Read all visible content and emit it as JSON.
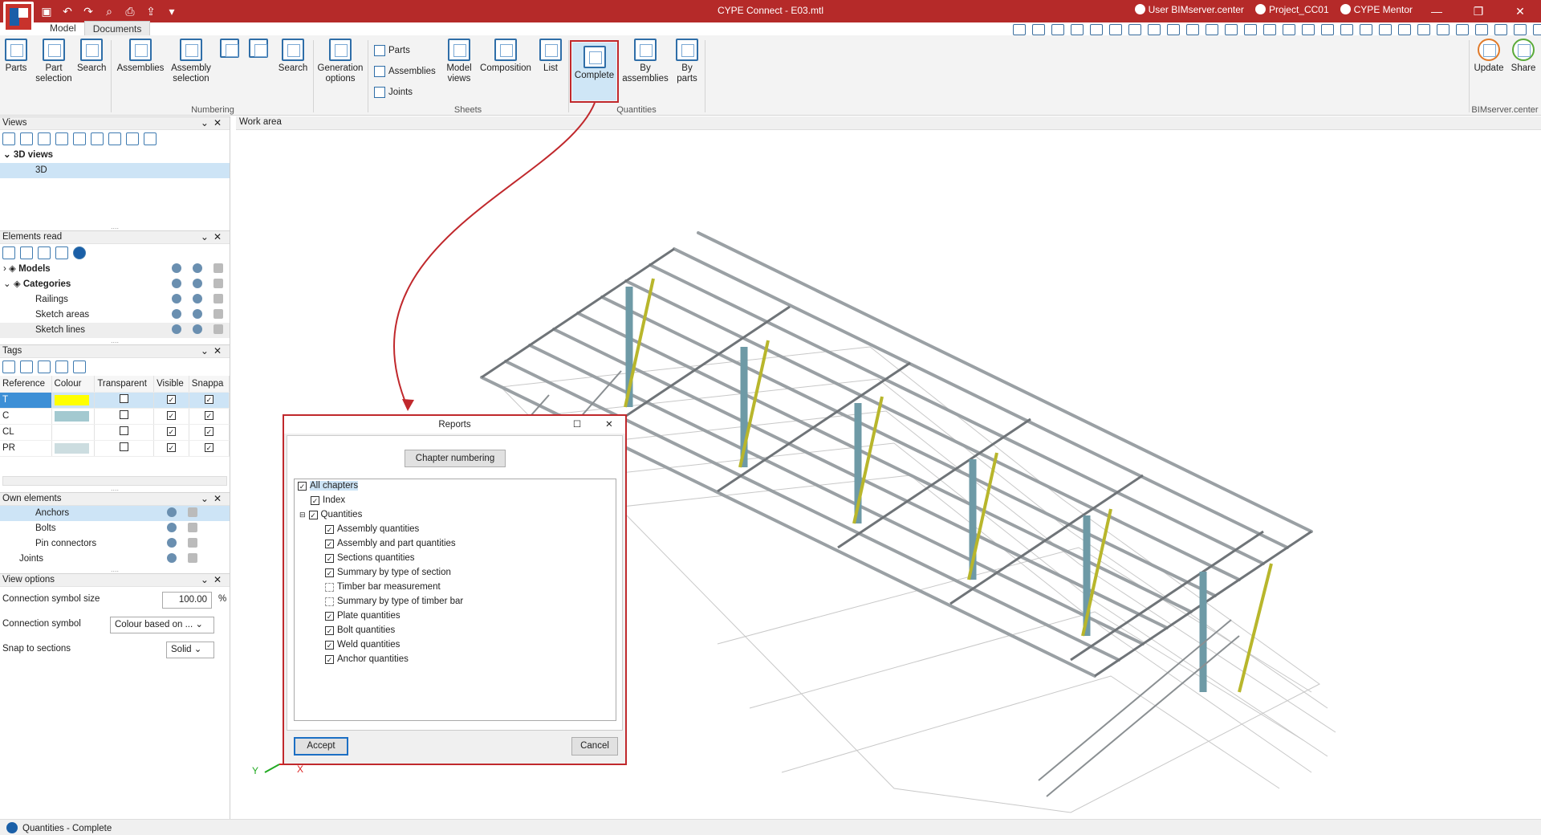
{
  "window": {
    "title": "CYPE Connect - E03.mtl"
  },
  "top_right": {
    "user": "User BIMserver.center",
    "project": "Project_CC01",
    "mentor": "CYPE Mentor"
  },
  "tabs": [
    {
      "label": "Model"
    },
    {
      "label": "Documents"
    }
  ],
  "ribbon": {
    "buttons": [
      {
        "label": "Parts"
      },
      {
        "label": "Part selection"
      },
      {
        "label": "Search"
      },
      {
        "label": "Assemblies"
      },
      {
        "label": "Assembly selection"
      },
      {
        "label": "Search"
      },
      {
        "label": "Generation options"
      },
      {
        "label": "Model views"
      },
      {
        "label": "Composition"
      },
      {
        "label": "List"
      },
      {
        "label": "Complete"
      },
      {
        "label": "By assemblies"
      },
      {
        "label": "By parts"
      },
      {
        "label": "Update"
      },
      {
        "label": "Share"
      }
    ],
    "sheets_small": [
      "Parts",
      "Assemblies",
      "Joints"
    ],
    "groups": [
      "Numbering",
      "Sheets",
      "Quantities",
      "BIMserver.center"
    ]
  },
  "panels": {
    "views": {
      "title": "Views",
      "tree": [
        "3D views",
        "3D"
      ]
    },
    "elements_read": {
      "title": "Elements read",
      "rows": [
        "Models",
        "Categories",
        "Railings",
        "Sketch areas",
        "Sketch lines"
      ]
    },
    "tags": {
      "title": "Tags",
      "columns": [
        "Reference",
        "Colour",
        "Transparent",
        "Visible",
        "Snappa"
      ],
      "rows": [
        {
          "ref": "T",
          "color": "#ffff00",
          "transparent": false,
          "visible": true,
          "snap": true
        },
        {
          "ref": "C",
          "color": "#a3c9d0",
          "transparent": false,
          "visible": true,
          "snap": true
        },
        {
          "ref": "CL",
          "color": "#ffffff",
          "transparent": false,
          "visible": true,
          "snap": true
        },
        {
          "ref": "PR",
          "color": "#ccdde0",
          "transparent": false,
          "visible": true,
          "snap": true
        }
      ]
    },
    "own_elements": {
      "title": "Own elements",
      "rows": [
        "Anchors",
        "Bolts",
        "Pin connectors",
        "Joints"
      ]
    },
    "view_options": {
      "title": "View options",
      "conn_size_label": "Connection symbol size",
      "conn_size_value": "100.00",
      "conn_size_unit": "%",
      "conn_symbol_label": "Connection symbol",
      "conn_symbol_value": "Colour based on ...",
      "snap_label": "Snap to sections",
      "snap_value": "Solid"
    }
  },
  "work_area": {
    "title": "Work area",
    "axis_x": "X",
    "axis_y": "Y"
  },
  "dialog": {
    "title": "Reports",
    "chapter_button": "Chapter numbering",
    "items": [
      {
        "label": "All chapters",
        "checked": true
      },
      {
        "label": "Index",
        "checked": true
      },
      {
        "label": "Quantities",
        "checked": true
      },
      {
        "label": "Assembly quantities",
        "checked": true
      },
      {
        "label": "Assembly and part quantities",
        "checked": true
      },
      {
        "label": "Sections quantities",
        "checked": true
      },
      {
        "label": "Summary by type of section",
        "checked": true
      },
      {
        "label": "Timber bar measurement",
        "checked": false
      },
      {
        "label": "Summary by type of timber bar",
        "checked": false
      },
      {
        "label": "Plate quantities",
        "checked": true
      },
      {
        "label": "Bolt quantities",
        "checked": true
      },
      {
        "label": "Weld quantities",
        "checked": true
      },
      {
        "label": "Anchor quantities",
        "checked": true
      }
    ],
    "accept": "Accept",
    "cancel": "Cancel"
  },
  "status": {
    "text": "Quantities - Complete"
  }
}
